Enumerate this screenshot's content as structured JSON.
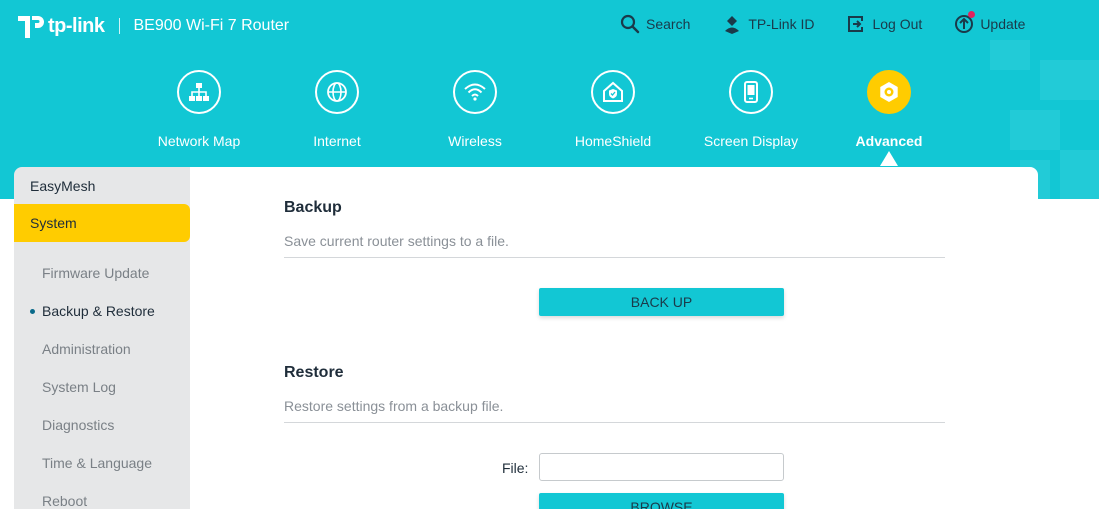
{
  "header": {
    "brand": "tp-link",
    "model": "BE900 Wi-Fi 7 Router",
    "actions": [
      {
        "label": "Search",
        "icon": "search-icon"
      },
      {
        "label": "TP-Link ID",
        "icon": "user-id-icon"
      },
      {
        "label": "Log Out",
        "icon": "logout-icon"
      },
      {
        "label": "Update",
        "icon": "update-icon"
      }
    ]
  },
  "nav": {
    "items": [
      {
        "label": "Network Map",
        "icon": "network-map-icon"
      },
      {
        "label": "Internet",
        "icon": "globe-icon"
      },
      {
        "label": "Wireless",
        "icon": "wifi-icon"
      },
      {
        "label": "HomeShield",
        "icon": "home-shield-icon"
      },
      {
        "label": "Screen Display",
        "icon": "screen-display-icon"
      },
      {
        "label": "Advanced",
        "icon": "gear-icon",
        "active": true
      }
    ]
  },
  "sidebar": {
    "top": "EasyMesh",
    "active": "System",
    "items": [
      {
        "label": "Firmware Update"
      },
      {
        "label": "Backup & Restore",
        "current": true
      },
      {
        "label": "Administration"
      },
      {
        "label": "System Log"
      },
      {
        "label": "Diagnostics"
      },
      {
        "label": "Time & Language"
      },
      {
        "label": "Reboot"
      }
    ]
  },
  "backup": {
    "title": "Backup",
    "desc": "Save current router settings to a file.",
    "button": "BACK UP"
  },
  "restore": {
    "title": "Restore",
    "desc": "Restore settings from a backup file.",
    "file_label": "File:",
    "file_value": "",
    "browse_button": "BROWSE"
  },
  "colors": {
    "header_bg": "#12c7d4",
    "accent_yellow": "#ffcc00",
    "badge_red": "#e0245e"
  }
}
